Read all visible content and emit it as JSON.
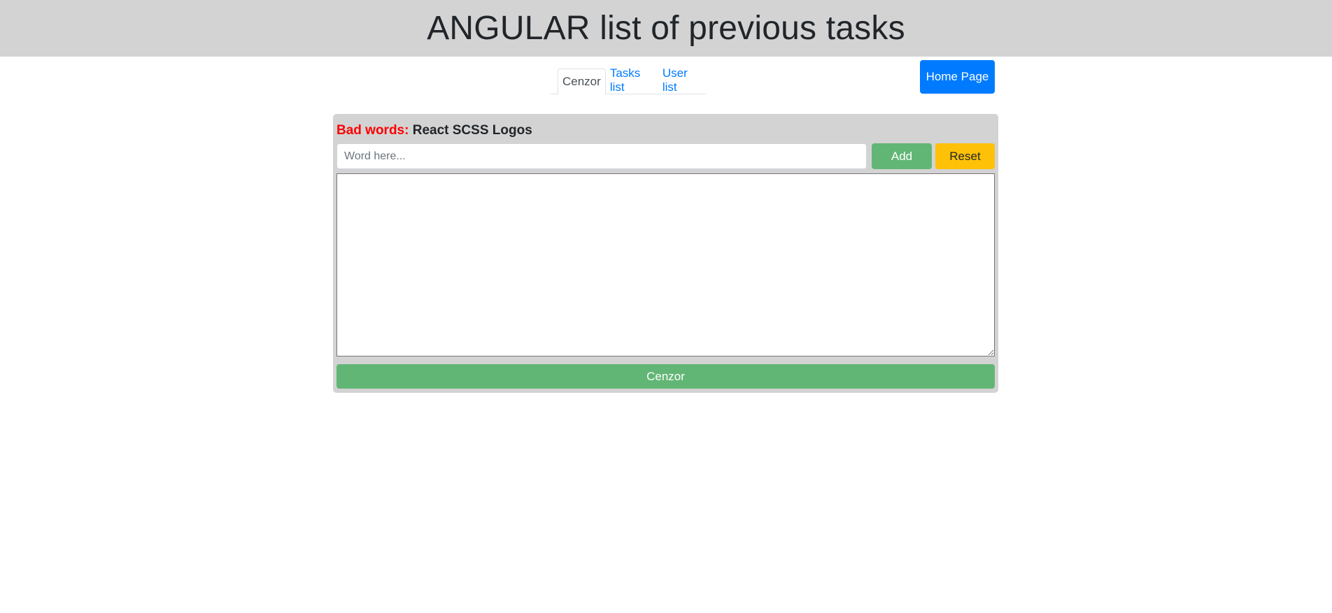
{
  "header": {
    "title": "ANGULAR list of previous tasks"
  },
  "home_button": {
    "label": "Home Page"
  },
  "tabs": [
    {
      "label": "Cenzor",
      "active": true
    },
    {
      "label": "Tasks list",
      "active": false
    },
    {
      "label": "User list",
      "active": false
    }
  ],
  "cenzor": {
    "bad_words_label": "Bad words:",
    "bad_words_value": "React SCSS Logos",
    "input_value": "",
    "input_placeholder": "Word here...",
    "add_label": "Add",
    "reset_label": "Reset",
    "textarea_value": "",
    "submit_label": "Cenzor"
  },
  "colors": {
    "header_bg": "#d3d3d3",
    "primary": "#007bff",
    "success": "#62b675",
    "warning": "#ffc107",
    "danger_text": "#ff0000"
  }
}
